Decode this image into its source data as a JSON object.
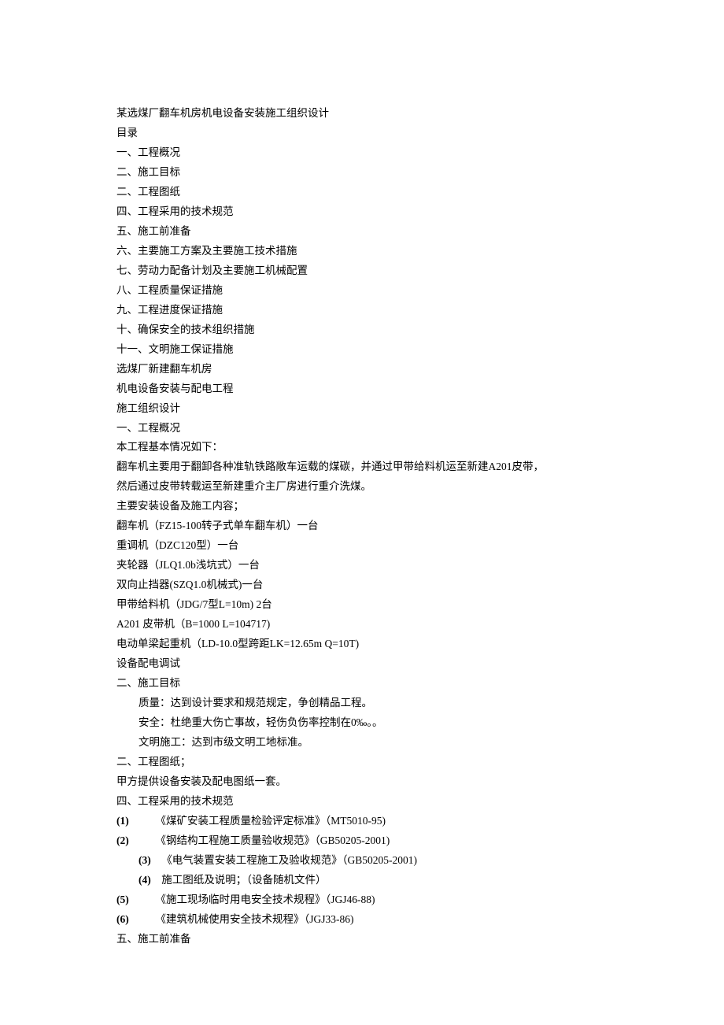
{
  "lines": [
    "某选煤厂翻车机房机电设备安装施工组织设计",
    "目录",
    "一、工程概况",
    "二、施工目标",
    "二、工程图纸",
    "四、工程采用的技术规范",
    "五、施工前准备",
    "六、主要施工方案及主要施工技术措施",
    "七、劳动力配备计划及主要施工机械配置",
    "八、工程质量保证措施",
    "九、工程进度保证措施",
    "十、确保安全的技术组织措施",
    "十一、文明施工保证措施",
    "选煤厂新建翻车机房",
    "机电设备安装与配电工程",
    "施工组织设计",
    "一、工程概况",
    "本工程基本情况如下：",
    "翻车机主要用于翻卸各种准轨铁路敞车运载的煤碳，并通过甲带给料机运至新建A201皮带，",
    "然后通过皮带转载运至新建重介主厂房进行重介洗煤。",
    "主要安装设备及施工内容；",
    "翻车机（FZ15-100转子式单车翻车机）一台",
    "重调机（DZC120型）一台",
    "夹轮器（JLQ1.0b浅坑式）一台",
    "双向止挡器(SZQ1.0机械式)一台",
    "甲带给料机（JDG/7型L=10m) 2台",
    "A201 皮带机（B=1000 L=104717)",
    "电动单梁起重机（LD-10.0型跨距LK=12.65m Q=10T)",
    "设备配电调试",
    "二、施工目标",
    "质量：达到设计要求和规范规定，争创精品工程。",
    "安全：杜绝重大伤亡事故，轻伤负伤率控制在0‰。。",
    "文明施工：达到市级文明工地标准。",
    "二、工程图纸；",
    "甲方提供设备安装及配电图纸一套。",
    "四、工程采用的技术规范"
  ],
  "specs": [
    {
      "num": "(1)",
      "text": "《煤矿安装工程质量检验评定标准》（MT5010-95)",
      "indent": 0
    },
    {
      "num": "(2)",
      "text": "《钢结构工程施工质量验收规范》（GB50205-2001)",
      "indent": 0
    },
    {
      "num": "(3)",
      "text": "《电气装置安装工程施工及验收规范》（GB50205-2001)",
      "indent": 1
    },
    {
      "num": "(4)",
      "text": "施工图纸及说明；（设备随机文件）",
      "indent": 1
    },
    {
      "num": "(5)",
      "text": "《施工现场临时用电安全技术规程》（JGJ46-88)",
      "indent": 0
    },
    {
      "num": "(6)",
      "text": "《建筑机械使用安全技术规程》（JGJ33-86)",
      "indent": 0
    }
  ],
  "tail": "五、施工前准备",
  "indented": [
    30,
    31,
    32
  ]
}
